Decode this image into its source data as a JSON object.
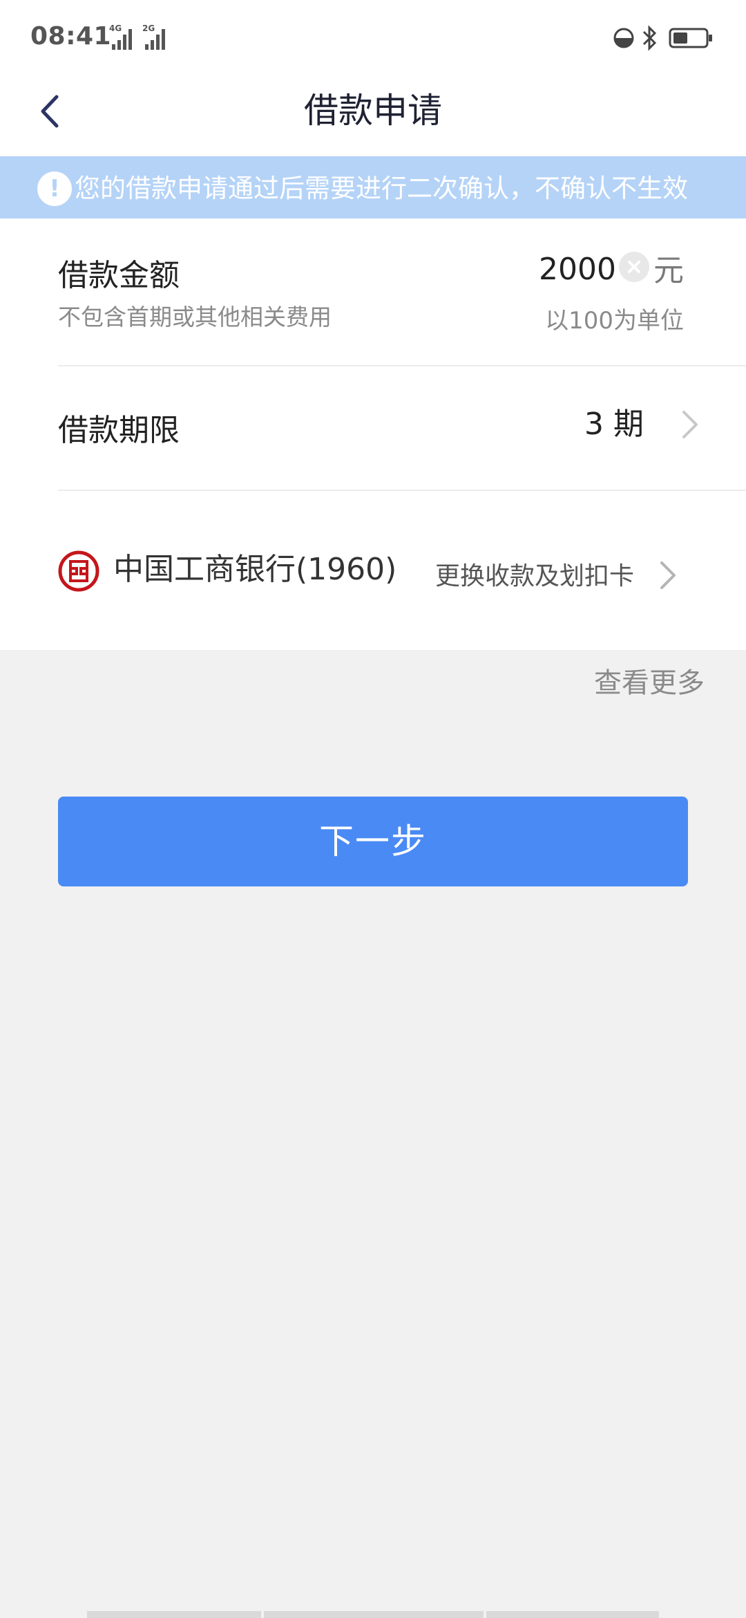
{
  "status_bar": {
    "time": "08:41",
    "signal1_label": "4G",
    "signal2_label": "2G"
  },
  "header": {
    "title": "借款申请"
  },
  "notice": {
    "text": "您的借款申请通过后需要进行二次确认，不确认不生效"
  },
  "loan_amount": {
    "label": "借款金额",
    "sublabel": "不包含首期或其他相关费用",
    "value": "2000",
    "unit": "元",
    "hint": "以100为单位"
  },
  "loan_term": {
    "label": "借款期限",
    "value": "3 期"
  },
  "bank": {
    "name": "中国工商银行(1960)",
    "change_label": "更换收款及划扣卡",
    "logo_color": "#c4161c"
  },
  "view_more_label": "查看更多",
  "next_button_label": "下一步",
  "colors": {
    "primary": "#4a8af4",
    "notice_bg": "#b5d3f7",
    "page_bg": "#f1f1f1"
  }
}
